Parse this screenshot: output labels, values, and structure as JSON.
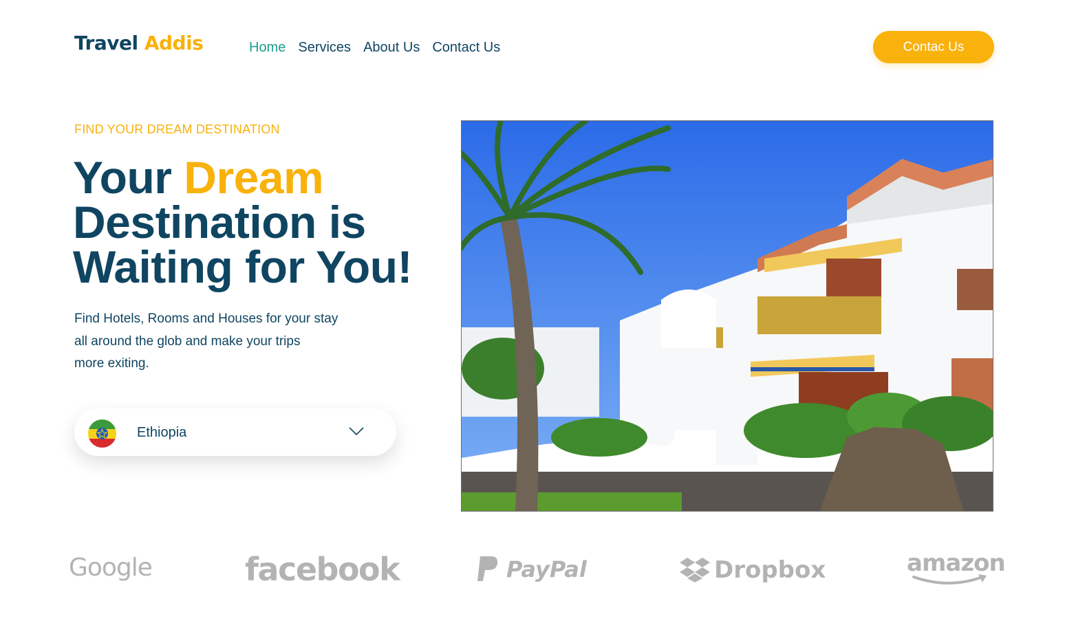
{
  "header": {
    "logo_part1": "Travel",
    "logo_part2": "Addis",
    "nav": [
      "Home",
      "Services",
      "About Us",
      "Contact Us"
    ],
    "cta_label": "Contac Us"
  },
  "hero": {
    "eyebrow": "FIND YOUR DREAM DESTINATION",
    "headline_part1": "Your ",
    "headline_highlight": "Dream",
    "headline_part2": "Destination is Waiting for You!",
    "subtitle_line1": "Find Hotels, Rooms and Houses for your stay",
    "subtitle_line2": "all around the glob and make your trips",
    "subtitle_line3": "more exiting.",
    "country_select": {
      "selected": "Ethiopia",
      "flag_icon": "ethiopia-flag-icon",
      "chevron_icon": "chevron-down-icon"
    }
  },
  "brands": [
    "Google",
    "facebook",
    "PayPal",
    "Dropbox",
    "amazon"
  ],
  "colors": {
    "primary": "#0f4561",
    "accent": "#f9b10b",
    "nav_active": "#1e9c8e",
    "brand_gray": "#b3b3b3"
  }
}
